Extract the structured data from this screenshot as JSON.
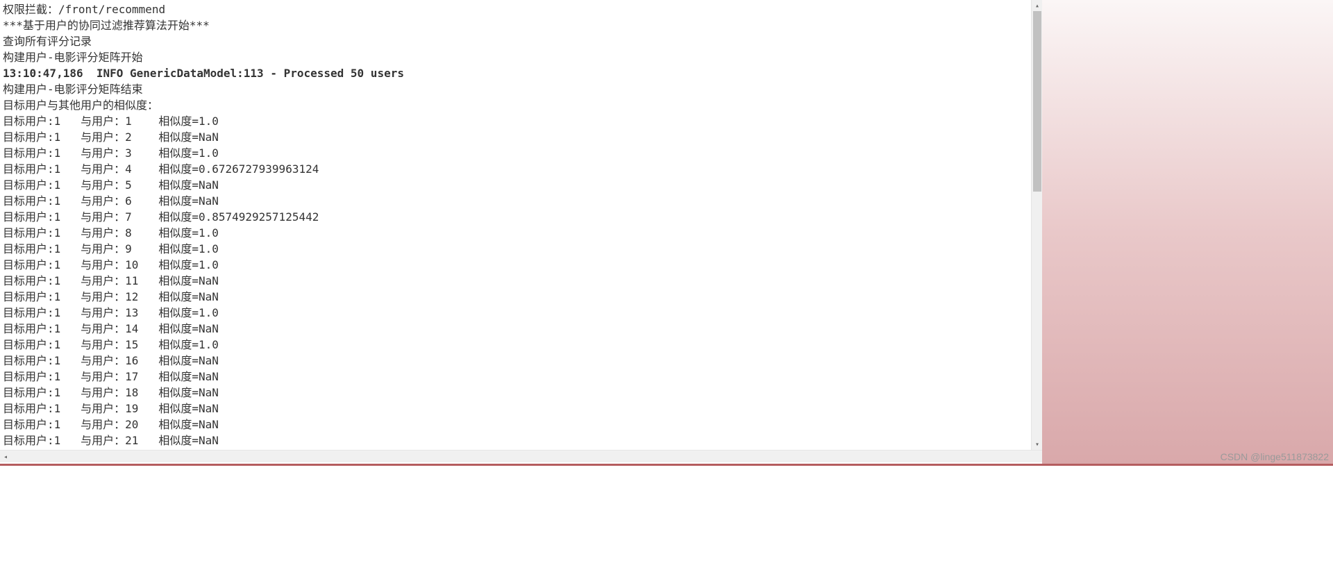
{
  "console": {
    "header_lines": [
      "权限拦截：/front/recommend",
      "***基于用户的协同过滤推荐算法开始***",
      "查询所有评分记录",
      "构建用户-电影评分矩阵开始",
      "13:10:47,186  INFO GenericDataModel:113 - Processed 50 users",
      "构建用户-电影评分矩阵结束",
      "目标用户与其他用户的相似度："
    ],
    "bold_line_index": 4,
    "target_label": "目标用户:",
    "with_user_label": "与用户：",
    "similarity_label": "相似度=",
    "target_id": "1",
    "similarity_rows": [
      {
        "user": "1",
        "sim": "1.0"
      },
      {
        "user": "2",
        "sim": "NaN"
      },
      {
        "user": "3",
        "sim": "1.0"
      },
      {
        "user": "4",
        "sim": "0.6726727939963124"
      },
      {
        "user": "5",
        "sim": "NaN"
      },
      {
        "user": "6",
        "sim": "NaN"
      },
      {
        "user": "7",
        "sim": "0.8574929257125442"
      },
      {
        "user": "8",
        "sim": "1.0"
      },
      {
        "user": "9",
        "sim": "1.0"
      },
      {
        "user": "10",
        "sim": "1.0"
      },
      {
        "user": "11",
        "sim": "NaN"
      },
      {
        "user": "12",
        "sim": "NaN"
      },
      {
        "user": "13",
        "sim": "1.0"
      },
      {
        "user": "14",
        "sim": "NaN"
      },
      {
        "user": "15",
        "sim": "1.0"
      },
      {
        "user": "16",
        "sim": "NaN"
      },
      {
        "user": "17",
        "sim": "NaN"
      },
      {
        "user": "18",
        "sim": "NaN"
      },
      {
        "user": "19",
        "sim": "NaN"
      },
      {
        "user": "20",
        "sim": "NaN"
      },
      {
        "user": "21",
        "sim": "NaN"
      }
    ]
  },
  "watermark": {
    "text": "CSDN @linge511873822"
  }
}
